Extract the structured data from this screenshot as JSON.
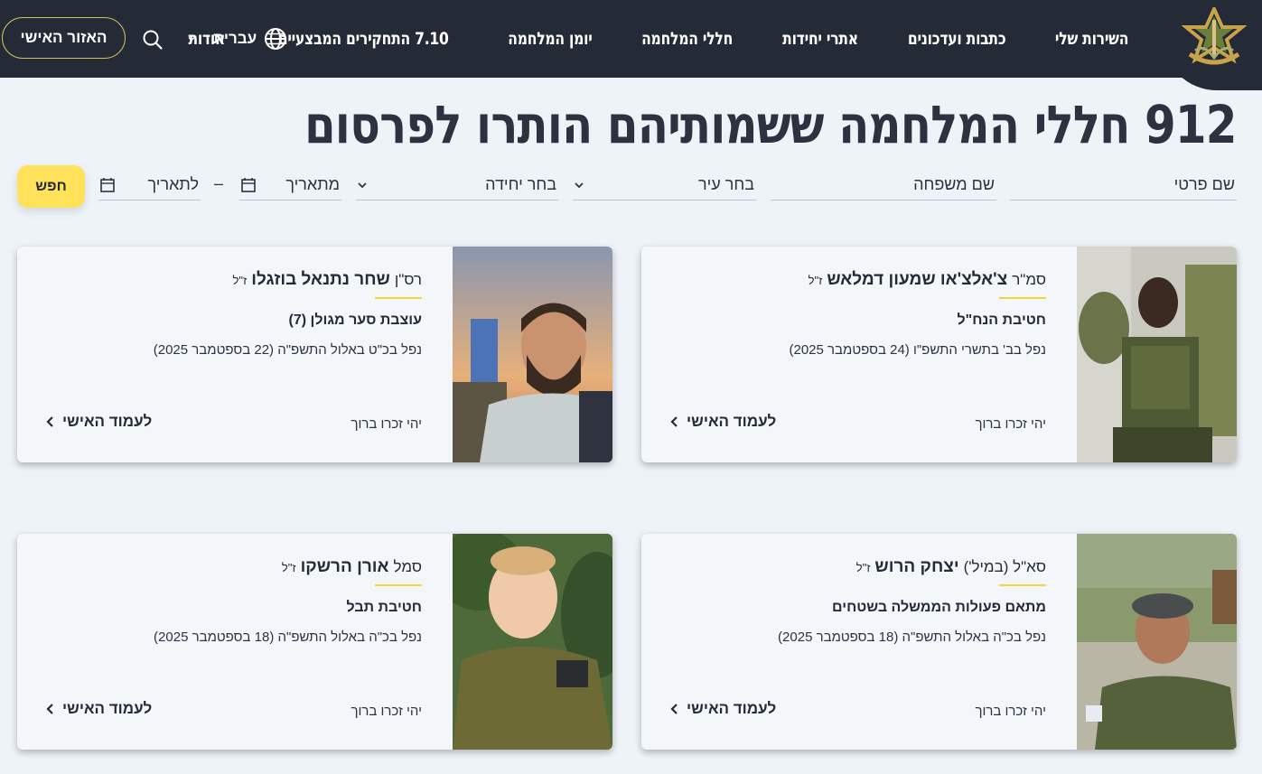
{
  "header": {
    "nav": [
      "השירות שלי",
      "כתבות ועדכונים",
      "אתרי יחידות",
      "חללי המלחמה",
      "יומן המלחמה",
      "7.10 התחקירים המבצעיים",
      "אודות"
    ],
    "language": "עברית",
    "personal_area": "האזור האישי",
    "icons": {
      "logo": "idf-emblem-logo",
      "globe": "globe-icon",
      "search": "search-icon"
    }
  },
  "page": {
    "title": "912 חללי המלחמה ששמותיהם הותרו לפרסום"
  },
  "filters": {
    "first_name": "שם פרטי",
    "last_name": "שם משפחה",
    "city": "בחר עיר",
    "unit": "בחר יחידה",
    "from_date": "מתאריך",
    "to_date": "לתאריך",
    "dash": "–",
    "search_button": "חפש"
  },
  "cards": [
    {
      "rank": "סמ\"ר",
      "name": "צ'אלצ'או שמעון דמלאש",
      "zl": "ז\"ל",
      "unit": "חטיבת הנח\"ל",
      "fell": "נפל בב' בתשרי התשפ\"ו (24 בספטמבר 2025)",
      "bless": "יהי זכרו ברוך",
      "link": "לעמוד האישי"
    },
    {
      "rank": "רס\"ן",
      "name": "שחר נתנאל בוזגלו",
      "zl": "ז\"ל",
      "unit": "עוצבת סער מגולן (7)",
      "fell": "נפל בכ\"ט באלול התשפ\"ה (22 בספטמבר 2025)",
      "bless": "יהי זכרו ברוך",
      "link": "לעמוד האישי"
    },
    {
      "rank": "סא\"ל (במיל')",
      "name": "יצחק הרוש",
      "zl": "ז\"ל",
      "unit": "מתאם פעולות הממשלה בשטחים",
      "fell": "נפל בכ\"ה באלול התשפ\"ה (18 בספטמבר 2025)",
      "bless": "יהי זכרו ברוך",
      "link": "לעמוד האישי"
    },
    {
      "rank": "סמל",
      "name": "אורן הרשקו",
      "zl": "ז\"ל",
      "unit": "חטיבת תבל",
      "fell": "נפל בכ\"ה באלול התשפ\"ה (18 בספטמבר 2025)",
      "bless": "יהי זכרו ברוך",
      "link": "לעמוד האישי"
    }
  ],
  "colors": {
    "header_bg": "#252a37",
    "accent_yellow": "#ffe25a",
    "underline": "#f4d53c",
    "page_bg": "#eef3f8"
  }
}
